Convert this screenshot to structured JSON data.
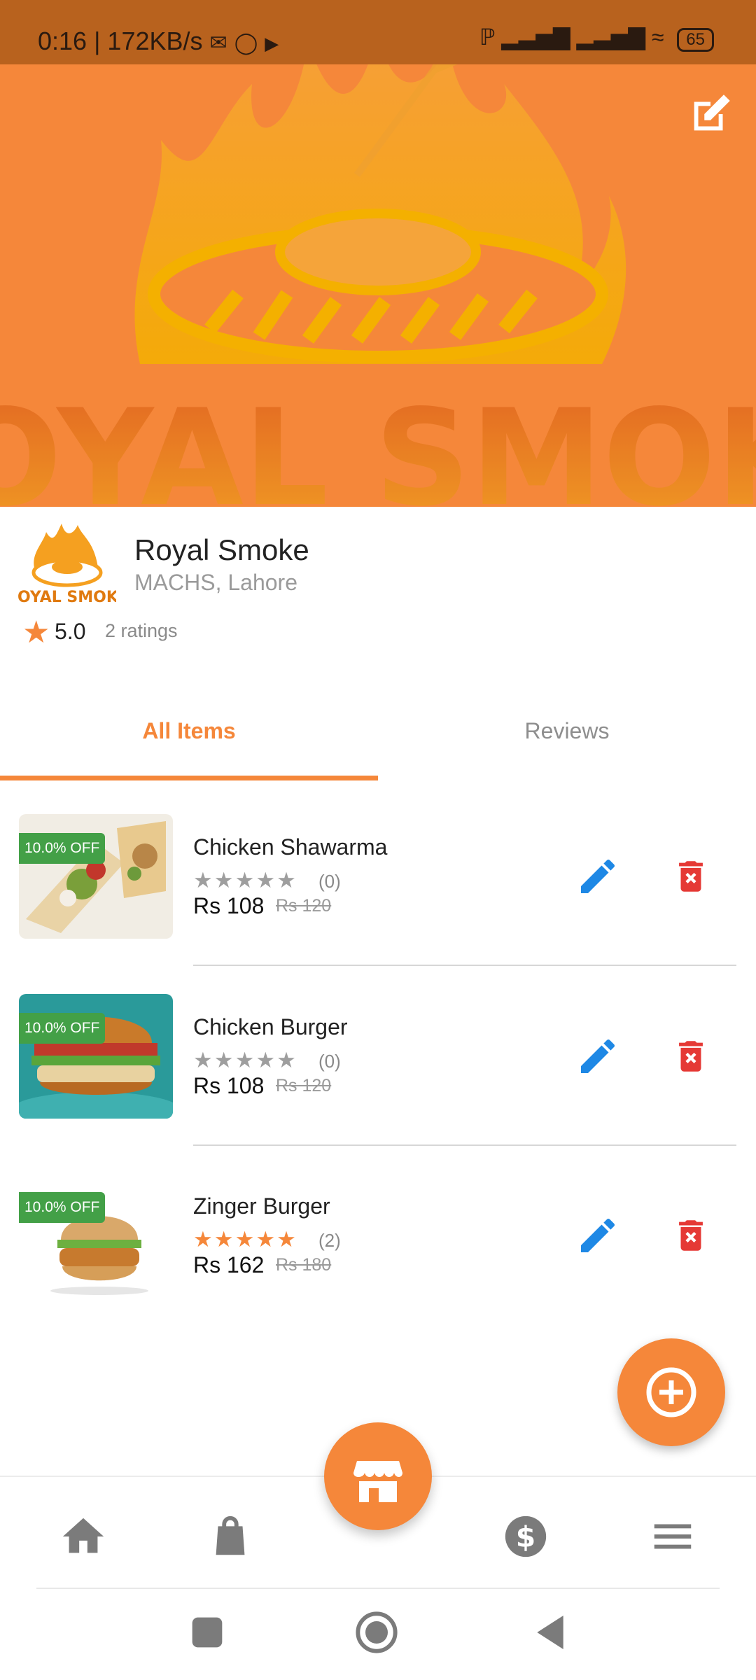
{
  "status_bar": {
    "time_speed": "0:16 | 172KB/s",
    "battery": "65"
  },
  "banner": {
    "wordmark": "ROYAL SMOKE"
  },
  "restaurant": {
    "name": "Royal Smoke",
    "location": "MACHS, Lahore",
    "rating": "5.0",
    "ratings_count": "2 ratings",
    "logo_text": "ROYAL SMOKE"
  },
  "tabs": [
    {
      "label": "All Items"
    },
    {
      "label": "Reviews"
    }
  ],
  "items": [
    {
      "name": "Chicken Shawarma",
      "discount": "10.0% OFF",
      "rating_count": "(0)",
      "stars_filled": 0,
      "price": "Rs 108",
      "old_price": "Rs 120"
    },
    {
      "name": "Chicken Burger",
      "discount": "10.0% OFF",
      "rating_count": "(0)",
      "stars_filled": 0,
      "price": "Rs 108",
      "old_price": "Rs 120"
    },
    {
      "name": "Zinger Burger",
      "discount": "10.0% OFF",
      "rating_count": "(2)",
      "stars_filled": 5,
      "price": "Rs 162",
      "old_price": "Rs 180"
    }
  ],
  "colors": {
    "accent": "#F5873A",
    "edit": "#1E88E5",
    "delete": "#E53935",
    "discount_badge": "#43A047"
  },
  "nav": {
    "items": [
      "home-icon",
      "shopping-bag-icon",
      "store-icon",
      "dollar-icon",
      "menu-icon"
    ],
    "active": "store-icon"
  }
}
